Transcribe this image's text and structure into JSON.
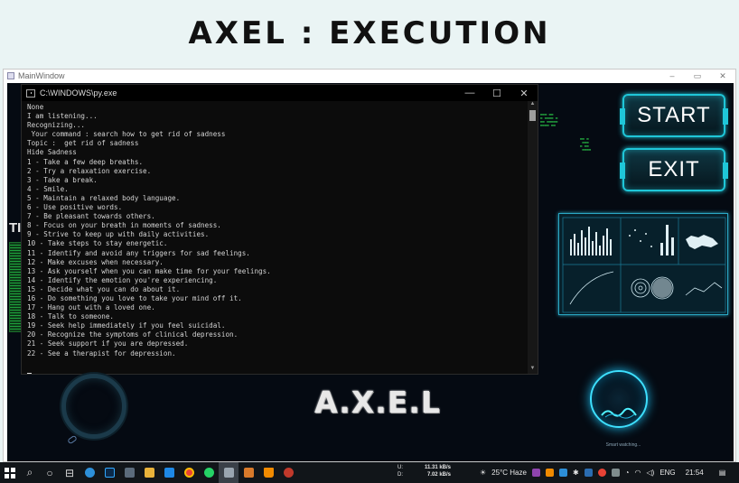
{
  "banner": {
    "title": "AXEL : EXECUTION"
  },
  "main_window": {
    "title": "MainWindow",
    "controls": {
      "minimize": "–",
      "maximize": "▭",
      "close": "✕"
    }
  },
  "console": {
    "title": "C:\\WINDOWS\\py.exe",
    "controls": {
      "minimize": "—",
      "maximize": "☐",
      "close": "✕"
    },
    "lines": [
      "None",
      "I am listening...",
      "Recognizing...",
      " Your command : search how to get rid of sadness",
      "Topic :  get rid of sadness",
      "Hide Sadness",
      "1 - Take a few deep breaths.",
      "2 - Try a relaxation exercise.",
      "3 - Take a break.",
      "4 - Smile.",
      "5 - Maintain a relaxed body language.",
      "6 - Use positive words.",
      "7 - Be pleasant towards others.",
      "8 - Focus on your breath in moments of sadness.",
      "9 - Strive to keep up with daily activities.",
      "10 - Take steps to stay energetic.",
      "11 - Identify and avoid any triggers for sad feelings.",
      "12 - Make excuses when necessary.",
      "13 - Ask yourself when you can make time for your feelings.",
      "14 - Identify the emotion you're experiencing.",
      "15 - Decide what you can do about it.",
      "16 - Do something you love to take your mind off it.",
      "17 - Hang out with a loved one.",
      "18 - Talk to someone.",
      "19 - Seek help immediately if you feel suicidal.",
      "20 - Recognize the symptoms of clinical depression.",
      "21 - Seek support if you are depressed.",
      "22 - See a therapist for depression."
    ]
  },
  "hud": {
    "start_label": "START",
    "exit_label": "EXIT",
    "brand": "A.X.E.L",
    "side_text": "TI",
    "status": "Smart watching..."
  },
  "taskbar": {
    "net_up_label": "U:",
    "net_up": "11.31 kB/s",
    "net_down_label": "D:",
    "net_down": "7.02 kB/s",
    "weather": "25°C  Haze",
    "language": "ENG",
    "time": "21:54"
  },
  "colors": {
    "accent": "#1fc6d8",
    "console_bg": "#0c0c0c",
    "taskbar": "#111519"
  }
}
